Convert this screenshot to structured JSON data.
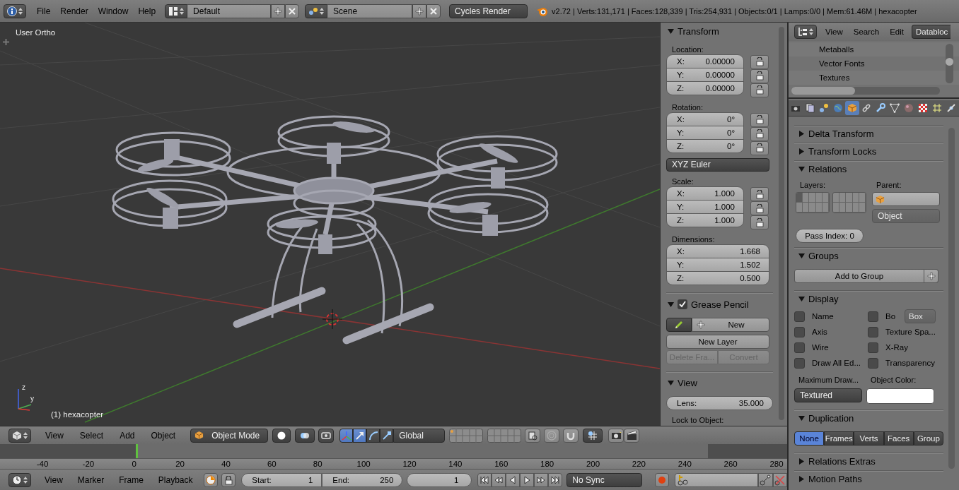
{
  "top_bar": {
    "menus": [
      "File",
      "Render",
      "Window",
      "Help"
    ],
    "screen_layout": "Default",
    "scene": "Scene",
    "render_engine": "Cycles Render",
    "stats": "v2.72 | Verts:131,171 | Faces:128,339 | Tris:254,931 | Objects:0/1 | Lamps:0/0 | Mem:61.46M | hexacopter"
  },
  "viewport": {
    "view_name": "User Ortho",
    "object_label": "(1) hexacopter",
    "gizmo_labels": [
      "z",
      "y"
    ]
  },
  "n_panel": {
    "transform": {
      "title": "Transform",
      "expanded": true,
      "location": {
        "label": "Location:",
        "fields": [
          {
            "axis": "X:",
            "value": "0.00000",
            "locked": false
          },
          {
            "axis": "Y:",
            "value": "0.00000",
            "locked": false
          },
          {
            "axis": "Z:",
            "value": "0.00000",
            "locked": false
          }
        ]
      },
      "rotation": {
        "label": "Rotation:",
        "fields": [
          {
            "axis": "X:",
            "value": "0°",
            "locked": false
          },
          {
            "axis": "Y:",
            "value": "0°",
            "locked": false
          },
          {
            "axis": "Z:",
            "value": "0°",
            "locked": false
          }
        ]
      },
      "rotation_mode": "XYZ Euler",
      "scale": {
        "label": "Scale:",
        "fields": [
          {
            "axis": "X:",
            "value": "1.000",
            "locked": false
          },
          {
            "axis": "Y:",
            "value": "1.000",
            "locked": false
          },
          {
            "axis": "Z:",
            "value": "1.000",
            "locked": false
          }
        ]
      },
      "dimensions": {
        "label": "Dimensions:",
        "fields": [
          {
            "axis": "X:",
            "value": "1.668"
          },
          {
            "axis": "Y:",
            "value": "1.502"
          },
          {
            "axis": "Z:",
            "value": "0.500"
          }
        ]
      }
    },
    "grease_pencil": {
      "title": "Grease Pencil",
      "expanded": true,
      "enabled": true,
      "new_button": "New",
      "new_layer_button": "New Layer",
      "actions": [
        {
          "label": "Delete Fra...",
          "disabled": true
        },
        {
          "label": "Convert",
          "disabled": true
        }
      ]
    },
    "view": {
      "title": "View",
      "expanded": true,
      "lens_label": "Lens:",
      "lens_value": "35.000",
      "lock_label": "Lock to Object:"
    }
  },
  "outliner": {
    "menus": [
      "View",
      "Search",
      "Edit"
    ],
    "display_mode": "Databloc",
    "items": [
      "Metaballs",
      "Vector Fonts",
      "Textures"
    ]
  },
  "properties": {
    "tabs": [
      {
        "kind": "render",
        "selected": false
      },
      {
        "kind": "layers",
        "selected": false
      },
      {
        "kind": "scene",
        "selected": false
      },
      {
        "kind": "world",
        "selected": false
      },
      {
        "kind": "object",
        "selected": true
      },
      {
        "kind": "constraints",
        "selected": false
      },
      {
        "kind": "modifiers",
        "selected": false
      },
      {
        "kind": "data",
        "selected": false
      },
      {
        "kind": "material",
        "selected": false
      },
      {
        "kind": "texture",
        "selected": false
      },
      {
        "kind": "particles",
        "selected": false
      },
      {
        "kind": "physics",
        "selected": false
      }
    ],
    "panels": [
      {
        "title": "Delta Transform",
        "expanded": false
      },
      {
        "title": "Transform Locks",
        "expanded": false
      },
      {
        "kind": "relations",
        "title": "Relations",
        "expanded": true,
        "layers_label": "Layers:",
        "parent_label": "Parent:",
        "parent_type": "Object",
        "parent_type_disabled": true,
        "pass_index_label": "Pass Index:",
        "pass_index": "0",
        "layers": [
          {
            "selected": true
          },
          {
            "selected": false
          },
          {
            "selected": false
          },
          {
            "selected": false
          },
          {
            "selected": false
          },
          {
            "selected": false
          },
          {
            "selected": false
          },
          {
            "selected": false
          },
          {
            "selected": false
          },
          {
            "selected": false
          },
          {
            "selected": false
          },
          {
            "selected": false
          },
          {
            "selected": false
          },
          {
            "selected": false
          },
          {
            "selected": false
          },
          {
            "selected": false
          },
          {
            "selected": false
          },
          {
            "selected": false
          },
          {
            "selected": false
          },
          {
            "selected": false
          }
        ]
      },
      {
        "kind": "groups",
        "title": "Groups",
        "expanded": true,
        "button": "Add to Group"
      },
      {
        "kind": "display",
        "title": "Display",
        "expanded": true,
        "options": [
          {
            "label": "Name",
            "checked": false
          },
          {
            "label": "Bo",
            "checked": false
          },
          {
            "label": "Axis",
            "checked": false
          },
          {
            "label": "Texture Spa...",
            "checked": false
          },
          {
            "label": "Wire",
            "checked": false
          },
          {
            "label": "X-Ray",
            "checked": false
          },
          {
            "label": "Draw All Ed...",
            "checked": false
          },
          {
            "label": "Transparency",
            "checked": false
          }
        ],
        "bounds_type": "Box",
        "bounds_disabled": true,
        "max_draw_label": "Maximum Draw...",
        "max_draw": "Textured",
        "color_label": "Object Color:",
        "color": "#ffffff"
      },
      {
        "kind": "duplication",
        "title": "Duplication",
        "expanded": true,
        "options": [
          {
            "label": "None",
            "selected": true
          },
          {
            "label": "Frames",
            "selected": false
          },
          {
            "label": "Verts",
            "selected": false
          },
          {
            "label": "Faces",
            "selected": false
          },
          {
            "label": "Group",
            "selected": false
          }
        ]
      },
      {
        "title": "Relations Extras",
        "expanded": false
      },
      {
        "title": "Motion Paths",
        "expanded": false
      }
    ]
  },
  "viewport_header": {
    "menus": [
      "View",
      "Select",
      "Add",
      "Object"
    ],
    "mode": "Object Mode",
    "orientation": "Global",
    "manipulators": [
      {
        "kind": "axes",
        "selected": true
      },
      {
        "kind": "translate",
        "selected": true
      },
      {
        "kind": "rotate",
        "selected": false
      },
      {
        "kind": "scale",
        "selected": false
      }
    ]
  },
  "timeline": {
    "ruler": [
      "-40",
      "-20",
      "0",
      "20",
      "40",
      "60",
      "80",
      "100",
      "120",
      "140",
      "160",
      "180",
      "200",
      "220",
      "240",
      "260",
      "280"
    ],
    "menus": [
      "View",
      "Marker",
      "Frame",
      "Playback"
    ],
    "start_label": "Start:",
    "start": "1",
    "end_label": "End:",
    "end": "250",
    "current_frame": "1",
    "sync": "No Sync"
  }
}
